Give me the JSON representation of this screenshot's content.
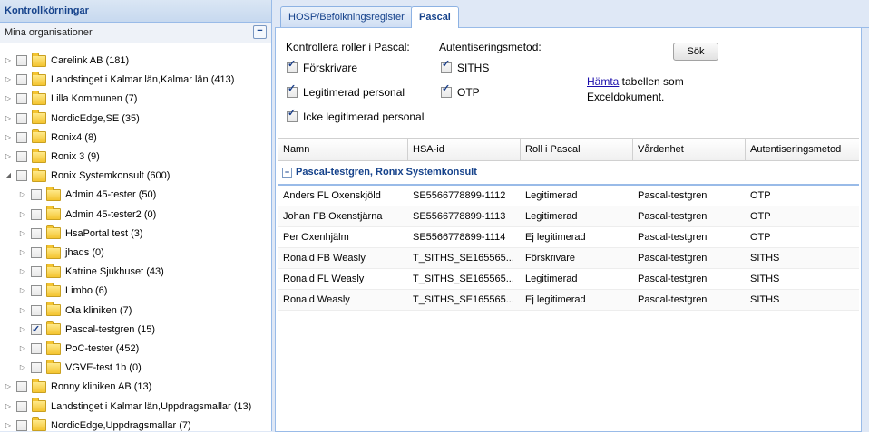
{
  "left_panel": {
    "title": "Kontrollkörningar",
    "subtitle": "Mina organisationer",
    "collapse_symbol": "−",
    "tree": [
      {
        "label": "Carelink AB (181)",
        "level": 0,
        "expander": "▷",
        "checked": false
      },
      {
        "label": "Landstinget i Kalmar län,Kalmar län (413)",
        "level": 0,
        "expander": "▷",
        "checked": false
      },
      {
        "label": "Lilla Kommunen (7)",
        "level": 0,
        "expander": "▷",
        "checked": false
      },
      {
        "label": "NordicEdge,SE (35)",
        "level": 0,
        "expander": "▷",
        "checked": false
      },
      {
        "label": "Ronix4 (8)",
        "level": 0,
        "expander": "▷",
        "checked": false
      },
      {
        "label": "Ronix 3 (9)",
        "level": 0,
        "expander": "▷",
        "checked": false
      },
      {
        "label": "Ronix Systemkonsult (600)",
        "level": 0,
        "expander": "◢",
        "checked": false
      },
      {
        "label": "Admin 45-tester (50)",
        "level": 1,
        "expander": "▷",
        "checked": false
      },
      {
        "label": "Admin 45-tester2 (0)",
        "level": 1,
        "expander": "▷",
        "checked": false
      },
      {
        "label": "HsaPortal test (3)",
        "level": 1,
        "expander": "▷",
        "checked": false
      },
      {
        "label": "jhads (0)",
        "level": 1,
        "expander": "▷",
        "checked": false
      },
      {
        "label": "Katrine Sjukhuset (43)",
        "level": 1,
        "expander": "▷",
        "checked": false
      },
      {
        "label": "Limbo (6)",
        "level": 1,
        "expander": "▷",
        "checked": false
      },
      {
        "label": "Ola kliniken (7)",
        "level": 1,
        "expander": "▷",
        "checked": false
      },
      {
        "label": "Pascal-testgren (15)",
        "level": 1,
        "expander": "▷",
        "checked": true
      },
      {
        "label": "PoC-tester (452)",
        "level": 1,
        "expander": "▷",
        "checked": false
      },
      {
        "label": "VGVE-test 1b (0)",
        "level": 1,
        "expander": "▷",
        "checked": false
      },
      {
        "label": "Ronny kliniken AB (13)",
        "level": 0,
        "expander": "▷",
        "checked": false
      },
      {
        "label": "Landstinget i Kalmar län,Uppdragsmallar (13)",
        "level": 0,
        "expander": "▷",
        "checked": false
      },
      {
        "label": "NordicEdge,Uppdragsmallar (7)",
        "level": 0,
        "expander": "▷",
        "checked": false
      }
    ]
  },
  "tabs": [
    {
      "label": "HOSP/Befolkningsregister",
      "active": false
    },
    {
      "label": "Pascal",
      "active": true
    }
  ],
  "controls": {
    "roles_heading": "Kontrollera roller i Pascal:",
    "roles": [
      {
        "label": "Förskrivare",
        "checked": true
      },
      {
        "label": "Legitimerad personal",
        "checked": true
      },
      {
        "label": "Icke legitimerad personal",
        "checked": true
      }
    ],
    "auth_heading": "Autentiseringsmetod:",
    "auth_methods": [
      {
        "label": "SITHS",
        "checked": true
      },
      {
        "label": "OTP",
        "checked": true
      }
    ],
    "search_label": "Sök",
    "export_link": "Hämta",
    "export_rest": " tabellen som Exceldokument."
  },
  "grid": {
    "columns": [
      "Namn",
      "HSA-id",
      "Roll i Pascal",
      "Vårdenhet",
      "Autentiseringsmetod"
    ],
    "group_toggle": "−",
    "group_label": "Pascal-testgren, Ronix Systemkonsult",
    "rows": [
      [
        "Anders FL Oxenskjöld",
        "SE5566778899-1112",
        "Legitimerad",
        "Pascal-testgren",
        "OTP"
      ],
      [
        "Johan FB Oxenstjärna",
        "SE5566778899-1113",
        "Legitimerad",
        "Pascal-testgren",
        "OTP"
      ],
      [
        "Per Oxenhjälm",
        "SE5566778899-1114",
        "Ej legitimerad",
        "Pascal-testgren",
        "OTP"
      ],
      [
        "Ronald FB Weasly",
        "T_SITHS_SE165565...",
        "Förskrivare",
        "Pascal-testgren",
        "SITHS"
      ],
      [
        "Ronald FL Weasly",
        "T_SITHS_SE165565...",
        "Legitimerad",
        "Pascal-testgren",
        "SITHS"
      ],
      [
        "Ronald Weasly",
        "T_SITHS_SE165565...",
        "Ej legitimerad",
        "Pascal-testgren",
        "SITHS"
      ]
    ]
  }
}
